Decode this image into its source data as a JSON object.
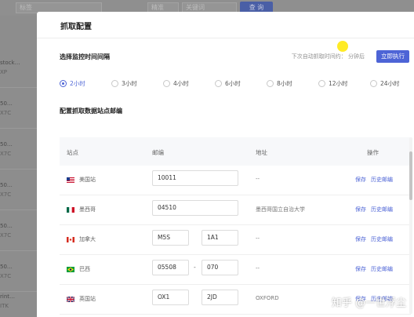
{
  "background": {
    "filter_placeholder": "标签",
    "filter_value": "精准",
    "keyword_placeholder": "关键词",
    "query_button": "查 询",
    "left_rows": [
      {
        "line1": "stock…",
        "line2": "XP"
      },
      {
        "line1": "50…",
        "line2": "X7C"
      },
      {
        "line1": "50…",
        "line2": "X7C"
      },
      {
        "line1": "50…",
        "line2": "X7C"
      },
      {
        "line1": "50…",
        "line2": "X7C"
      },
      {
        "line1": "50…",
        "line2": "X7C"
      },
      {
        "line1": "rint…",
        "line2": "ITK"
      }
    ]
  },
  "modal": {
    "title": "抓取配置",
    "interval_section_title": "选择监控时间间隔",
    "next_run_text": "下次自动抓取时间约： 分钟后",
    "run_now_button": "立即执行",
    "intervals": [
      {
        "label": "2小时",
        "checked": true
      },
      {
        "label": "3小时",
        "checked": false
      },
      {
        "label": "4小时",
        "checked": false
      },
      {
        "label": "6小时",
        "checked": false
      },
      {
        "label": "8小时",
        "checked": false
      },
      {
        "label": "12小时",
        "checked": false
      },
      {
        "label": "24小时",
        "checked": false
      }
    ],
    "zip_section_title": "配置抓取数据站点邮编",
    "table": {
      "headers": {
        "site": "站点",
        "zip": "邮编",
        "address": "地址",
        "actions": "操作"
      },
      "save_label": "保存",
      "history_label": "历史邮编",
      "rows": [
        {
          "site": "美国站",
          "flag": "us",
          "zip1": "10011",
          "zip2": "",
          "address": "--"
        },
        {
          "site": "墨西哥",
          "flag": "mx",
          "zip1": "04510",
          "zip2": "",
          "address": "墨西哥国立自治大学"
        },
        {
          "site": "加拿大",
          "flag": "ca",
          "zip1": "M5S",
          "zip2": "1A1",
          "address": "--"
        },
        {
          "site": "巴西",
          "flag": "br",
          "zip1": "05508",
          "zip2": "070",
          "address": "--"
        },
        {
          "site": "英国站",
          "flag": "uk",
          "zip1": "OX1",
          "zip2": "2JD",
          "address": "OXFORD"
        }
      ]
    }
  },
  "watermark": "知乎 @一世浮尘",
  "colors": {
    "accent": "#4d64d6",
    "overlay": "#7f7f7f"
  }
}
